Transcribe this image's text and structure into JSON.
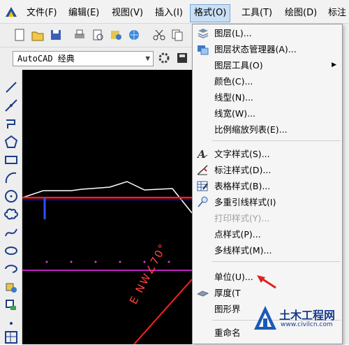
{
  "menubar": {
    "items": [
      {
        "label": "文件(F)"
      },
      {
        "label": "编辑(E)"
      },
      {
        "label": "视图(V)"
      },
      {
        "label": "插入(I)"
      },
      {
        "label": "格式(O)"
      },
      {
        "label": "工具(T)"
      },
      {
        "label": "绘图(D)"
      },
      {
        "label": "标注"
      }
    ]
  },
  "workspace": {
    "selected": "AutoCAD 经典"
  },
  "canvas": {
    "annotation_text": "E NW∠70°"
  },
  "format_menu": {
    "items": [
      {
        "label": "图层(L)...",
        "icon": "layers-icon",
        "enabled": true
      },
      {
        "label": "图层状态管理器(A)...",
        "icon": "layer-state-manager-icon",
        "enabled": true
      },
      {
        "label": "图层工具(O)",
        "icon": "",
        "enabled": true,
        "submenu": true
      },
      {
        "label": "颜色(C)...",
        "icon": "",
        "enabled": true
      },
      {
        "label": "线型(N)...",
        "icon": "",
        "enabled": true
      },
      {
        "label": "线宽(W)...",
        "icon": "",
        "enabled": true
      },
      {
        "label": "比例缩放列表(E)...",
        "icon": "",
        "enabled": true
      },
      {
        "label": "文字样式(S)...",
        "icon": "text-style-icon",
        "enabled": true
      },
      {
        "label": "标注样式(D)...",
        "icon": "dimension-style-icon",
        "enabled": true
      },
      {
        "label": "表格样式(B)...",
        "icon": "table-style-icon",
        "enabled": true
      },
      {
        "label": "多重引线样式(I)",
        "icon": "multileader-style-icon",
        "enabled": true
      },
      {
        "label": "打印样式(Y)...",
        "icon": "",
        "enabled": false
      },
      {
        "label": "点样式(P)...",
        "icon": "",
        "enabled": true
      },
      {
        "label": "多线样式(M)...",
        "icon": "",
        "enabled": true
      },
      {
        "label": "单位(U)...",
        "icon": "",
        "enabled": true
      },
      {
        "label": "厚度(T",
        "icon": "thickness-icon",
        "enabled": true
      },
      {
        "label": "图形界",
        "icon": "",
        "enabled": true
      },
      {
        "label": "重命名",
        "icon": "",
        "enabled": true
      }
    ]
  },
  "watermark": {
    "title": "土木工程网",
    "url": "www.civilcn.com"
  },
  "colors": {
    "menu_highlight": "#c9dff5",
    "canvas_bg": "#000000",
    "red_line": "#ff2020",
    "annotation_arrow": "#e02020"
  }
}
